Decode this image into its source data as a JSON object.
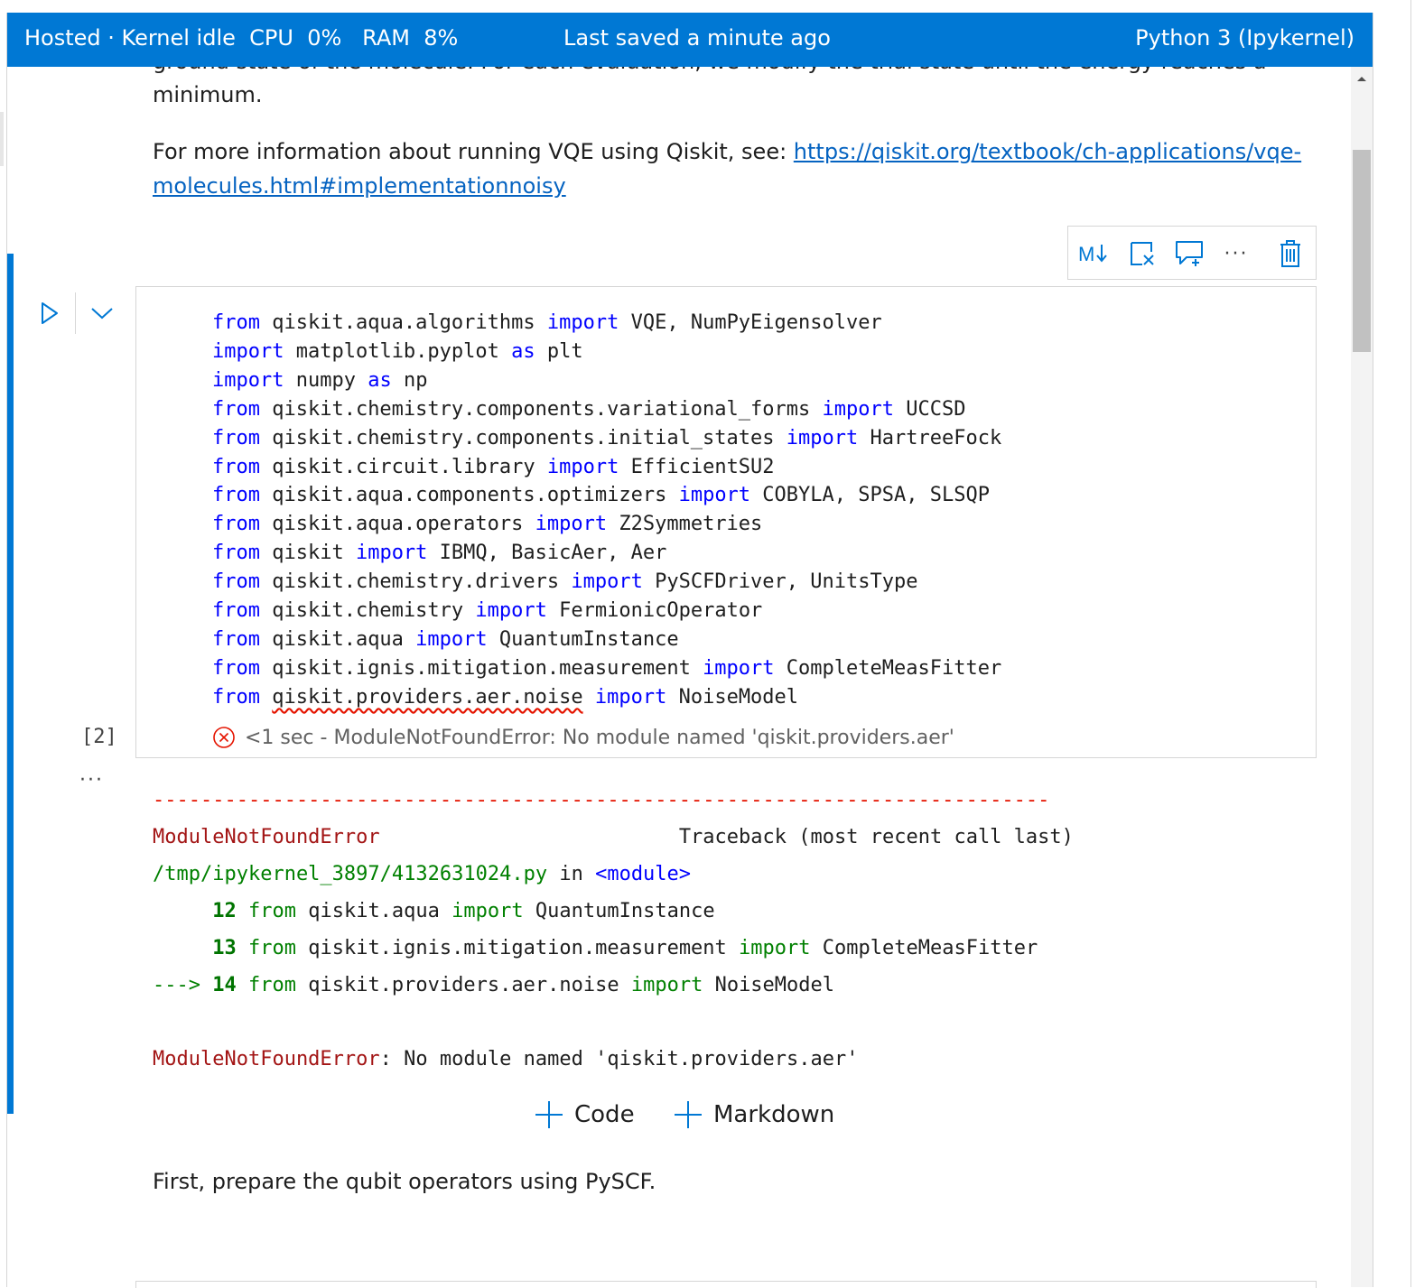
{
  "status_bar": {
    "left": "Hosted · Kernel idle  CPU  0%   RAM  8%",
    "center": "Last saved a minute ago",
    "right": "Python 3 (Ipykernel)"
  },
  "markdown_top": {
    "partial_line": "ground state of the molecule. For each evaluation, we modify the trial state until the energy reaches a",
    "line_end": "minimum.",
    "info_prefix": "For more information about running VQE using Qiskit, see: ",
    "info_link_part1": "https://qiskit.org/textbook/ch-applications/vqe-",
    "info_link_part2": "molecules.html#implementationnoisy"
  },
  "toolbar": {
    "markdown_icon": "markdown-toggle-icon",
    "clear_icon": "clear-output-icon",
    "comment_icon": "add-comment-icon",
    "more_label": "···",
    "delete_icon": "trash-icon"
  },
  "cell": {
    "execution_count": "[2]",
    "output_dots": "···",
    "status_time": "<1 sec",
    "status_sep": " - ",
    "status_error": "ModuleNotFoundError: No module named 'qiskit.providers.aer'",
    "code_lines": [
      [
        "from",
        " qiskit.aqua.algorithms ",
        "import",
        " VQE, NumPyEigensolver"
      ],
      [
        "import",
        " matplotlib.pyplot ",
        "as",
        " plt"
      ],
      [
        "import",
        " numpy ",
        "as",
        " np"
      ],
      [
        "from",
        " qiskit.chemistry.components.variational_forms ",
        "import",
        " UCCSD"
      ],
      [
        "from",
        " qiskit.chemistry.components.initial_states ",
        "import",
        " HartreeFock"
      ],
      [
        "from",
        " qiskit.circuit.library ",
        "import",
        " EfficientSU2"
      ],
      [
        "from",
        " qiskit.aqua.components.optimizers ",
        "import",
        " COBYLA, SPSA, SLSQP"
      ],
      [
        "from",
        " qiskit.aqua.operators ",
        "import",
        " Z2Symmetries"
      ],
      [
        "from",
        " qiskit ",
        "import",
        " IBMQ, BasicAer, Aer"
      ],
      [
        "from",
        " qiskit.chemistry.drivers ",
        "import",
        " PySCFDriver, UnitsType"
      ],
      [
        "from",
        " qiskit.chemistry ",
        "import",
        " FermionicOperator"
      ],
      [
        "from",
        " qiskit.aqua ",
        "import",
        " QuantumInstance"
      ],
      [
        "from",
        " qiskit.ignis.mitigation.measurement ",
        "import",
        " CompleteMeasFitter"
      ]
    ],
    "last_line": {
      "kw1": "from",
      "module": "qiskit.providers.aer.noise",
      "kw2": "import",
      "name": " NoiseModel"
    }
  },
  "output": {
    "dashes": "---------------------------------------------------------------------------",
    "error_name": "ModuleNotFoundError",
    "traceback_label": "Traceback (most recent call last)",
    "file_path": "/tmp/ipykernel_3897/4132631024.py",
    "in_word": " in ",
    "module_tag": "<module>",
    "trace_lines": [
      {
        "arrow": "     ",
        "num": "12",
        "kw1": "from",
        "mod": " qiskit.aqua ",
        "kw2": "import",
        "name": " QuantumInstance"
      },
      {
        "arrow": "     ",
        "num": "13",
        "kw1": "from",
        "mod": " qiskit.ignis.mitigation.measurement ",
        "kw2": "import",
        "name": " CompleteMeasFitter"
      },
      {
        "arrow": "---> ",
        "num": "14",
        "kw1": "from",
        "mod": " qiskit.providers.aer.noise ",
        "kw2": "import",
        "name": " NoiseModel"
      }
    ],
    "final_error_name": "ModuleNotFoundError",
    "final_error_msg": ": No module named 'qiskit.providers.aer'"
  },
  "add_cell": {
    "code_label": "Code",
    "markdown_label": "Markdown"
  },
  "markdown_bottom": {
    "text": "First, prepare the qubit operators using PySCF."
  },
  "colors": {
    "accent": "#0078d4",
    "keyword": "#0000ff",
    "error": "#a31515",
    "path": "#008000",
    "link": "#0563c1"
  }
}
